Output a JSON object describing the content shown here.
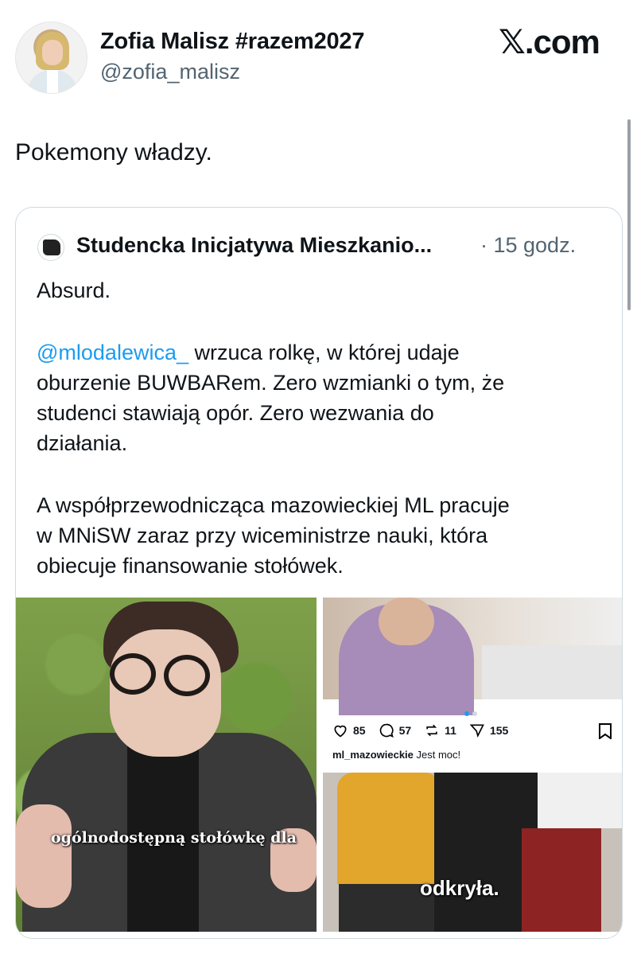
{
  "author": {
    "name": "Zofia Malisz #razem2027",
    "handle": "@zofia_malisz"
  },
  "site_logo": "𝕏.com",
  "tweet_text": "Pokemony władzy.",
  "quoted": {
    "name": "Studencka Inicjatywa Mieszkanio...",
    "time": "· 15 godz.",
    "line1": "Absurd.",
    "mention": "@mlodalewica_",
    "line2_rest": " wrzuca rolkę, w której udaje",
    "line3": "oburzenie BUWBARem. Zero wzmianki o tym, że",
    "line4": "studenci stawiają opór. Zero wezwania do",
    "line5": "działania.",
    "line6": "A współprzewodnicząca mazowieckiej ML pracuje",
    "line7": "w MNiSW zaraz przy wiceministrze nauki, która",
    "line8": "obiecuje finansowanie stołówek."
  },
  "media": {
    "left_caption": "ogólnodostępną stołówkę dla",
    "right_caption": "odkryła.",
    "ig": {
      "likes": "85",
      "comments": "57",
      "reposts": "11",
      "shares": "155",
      "user": "ml_mazowieckie",
      "caption": " Jest moc!"
    }
  },
  "colors": {
    "link": "#1d9bf0",
    "secondary_text": "#536471",
    "border": "#cfd9de"
  }
}
